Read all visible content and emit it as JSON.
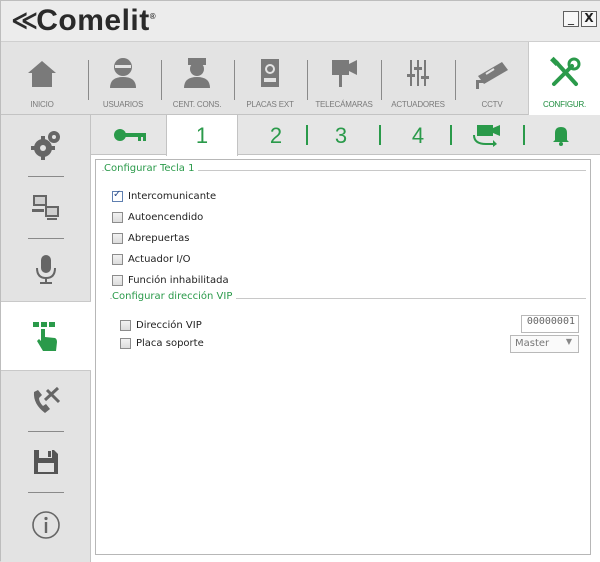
{
  "app": {
    "logo_mark": "≪",
    "logo_text": "Comelit",
    "logo_reg": "®",
    "win_min": "_",
    "win_close": "X"
  },
  "toolbar": {
    "items": [
      {
        "label": "INICIO",
        "icon": "home-icon"
      },
      {
        "label": "USUARIOS",
        "icon": "user-icon"
      },
      {
        "label": "CENT. CONS.",
        "icon": "concierge-icon"
      },
      {
        "label": "PLACAS EXT",
        "icon": "door-panel-icon"
      },
      {
        "label": "TELECÁMARAS",
        "icon": "camera-icon"
      },
      {
        "label": "ACTUADORES",
        "icon": "sliders-icon"
      },
      {
        "label": "CCTV",
        "icon": "cctv-icon"
      },
      {
        "label": "CONFIGUR.",
        "icon": "tools-icon",
        "active": true
      }
    ]
  },
  "sidebar": {
    "items": [
      {
        "icon": "gears-icon"
      },
      {
        "icon": "network-icon"
      },
      {
        "icon": "microphone-icon"
      },
      {
        "icon": "keypad-hand-icon",
        "active": true
      },
      {
        "icon": "phone-tools-icon"
      },
      {
        "icon": "save-icon"
      },
      {
        "icon": "info-icon"
      }
    ]
  },
  "subtabs": {
    "key_icon": "key-icon",
    "tabs": [
      "1",
      "2",
      "3",
      "4"
    ],
    "active": "1",
    "camera_icon": "camera-swap-icon",
    "bell_icon": "bell-icon"
  },
  "tecla": {
    "title": "Configurar Tecla 1",
    "options": [
      {
        "label": "Intercomunicante",
        "checked": true
      },
      {
        "label": "Autoencendido",
        "checked": false
      },
      {
        "label": "Abrepuertas",
        "checked": false
      },
      {
        "label": "Actuador I/O",
        "checked": false
      },
      {
        "label": "Función inhabilitada",
        "checked": false
      }
    ]
  },
  "vip": {
    "title": "Configurar dirección VIP",
    "direccion_label": "Dirección VIP",
    "direccion_value": "00000001",
    "placa_label": "Placa soporte",
    "placa_value": "Master"
  },
  "colors": {
    "accent_green": "#2a9a4a",
    "icon_gray": "#7a7a7a"
  }
}
